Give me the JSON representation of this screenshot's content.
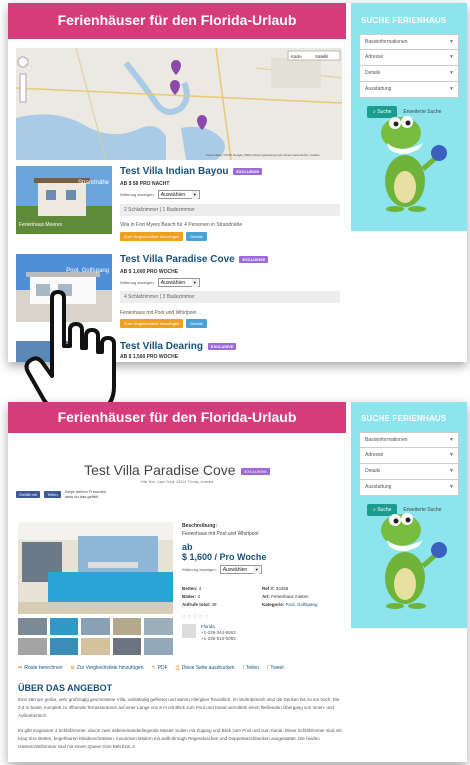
{
  "header_title": "Ferienhäuser für den Florida-Urlaub",
  "sidebar": {
    "title": "SUCHE FERIENHAUS",
    "rows": [
      "Basisinformationen",
      "Adresse",
      "Details",
      "Ausstattung"
    ],
    "search_button": "Suche",
    "advanced_link": "Erweiterte Suche"
  },
  "map": {
    "type_buttons": [
      "Karte",
      "Satellit"
    ],
    "footer": "Kartendaten ©2015 Google, INEGI  Nutzungsbedingungen  Einen Kartenfehler melden"
  },
  "listings": [
    {
      "title": "Test Villa Indian Bayou",
      "badge": "EXCLUSIVE",
      "price": "AB $ 58 PRO NACHT",
      "select_label": "Währung anzeigen:",
      "select_value": "Auswählen",
      "thumb_tag": "Strandnähe",
      "thumb_sub": "Ferienhaus Meeres",
      "rooms": "2 Schlafzimmer | 1 Badezimmer",
      "desc": "Villa in Fort Myers Beach für 4 Personen in Strandnähe",
      "btn1": "Zum Vergleichsliste hinzufügen",
      "btn2": "Details"
    },
    {
      "title": "Test Villa Paradise Cove",
      "badge": "EXCLUSIVE",
      "price": "AB $ 1,600 PRO WOCHE",
      "select_label": "Währung anzeigen:",
      "select_value": "Auswählen",
      "thumb_tag": "Pool, Golfspang",
      "thumb_sub": "",
      "rooms": "4 Schlafzimmer | 3 Badezimmer",
      "desc": "Ferienhaus mit Pool und Whirlpool",
      "btn1": "Zum Vergleichsliste hinzufügen",
      "btn2": "Details"
    },
    {
      "title": "Test Villa Dearing",
      "badge": "EXCLUSIVE",
      "price": "AB $ 1,500 PRO WOCHE"
    }
  ],
  "detail": {
    "title": "Test Villa Paradise Cove",
    "badge": "EXCLUSIVE",
    "breadcrumb": "Villa Test, Cape Coral, 33914, Florida, Amerika",
    "fb_share": "Gefällt mir",
    "fb_share2": "Teilen",
    "fb_note": "Zeige deinen Freunden, dass du das gefällt.",
    "desc_label": "Beschreibung:",
    "desc_text": "Ferienhaus mit Pool und Whirlpool",
    "price_ab": "ab",
    "price": "$ 1,600 / Pro Woche",
    "select_label": "Währung anzeigen:",
    "select_value": "Auswählen",
    "facts": [
      [
        "Betten:",
        "4",
        "Ref #:",
        "33458"
      ],
      [
        "Bäder:",
        "3",
        "Art:",
        "Ferienhaus mieten"
      ],
      [
        "Aufrufe total:",
        "39",
        "Kategorie:",
        "Pool, Golfspang"
      ]
    ],
    "contact_city": "Florida",
    "contact_phone1": "+1-239-344-8553",
    "contact_phone2": "+1-239-810-0092",
    "actions": [
      "Route berechnen",
      "Zur Vergleichsliste hinzufügen",
      "PDF",
      "Diese Seite ausdrucken",
      "Teilen",
      "Tweet"
    ],
    "section_title": "ÜBER DAS ANGEBOT",
    "para1": "Eine 260 qm große, sehr großzügig geschnittene Villa, vollständig geflieset und darum Allergiker freundlich. Im Wohnbereich sind die Decken bis zu 4m hoch. Die 3,3 m breite, komplett zu öffnende Terrassentüren auf einer Länge von 8 m mit Blick zum Pool und Kanal vermitteln einen fließenden Übergang von Innen- und Außenbereich.",
    "para2": "Es gibt insgesamt 4 Schlafzimmer, davon zwei nebeneinanderliegende Master Suiten mit Zugang und Blick zum Pool und zum Kanal. Diese Schlafzimmer sind mit King Size Betten, begehbaren Kleiderschränken, luxuriösen Bädern mit walk-through Regenduschen und Doppelwaschbecken ausgestattet. Die beiden Gästeschlafzimmer sind mit einem Queen Size Bett bzw. 2"
  },
  "colors": {
    "header": "#d63c7c",
    "sidebar": "#8ce4ed",
    "link": "#17517c",
    "button_orange": "#f0a020",
    "button_blue": "#49a1d8",
    "badge": "#9b6cd8",
    "teal": "#1a9c8e"
  }
}
